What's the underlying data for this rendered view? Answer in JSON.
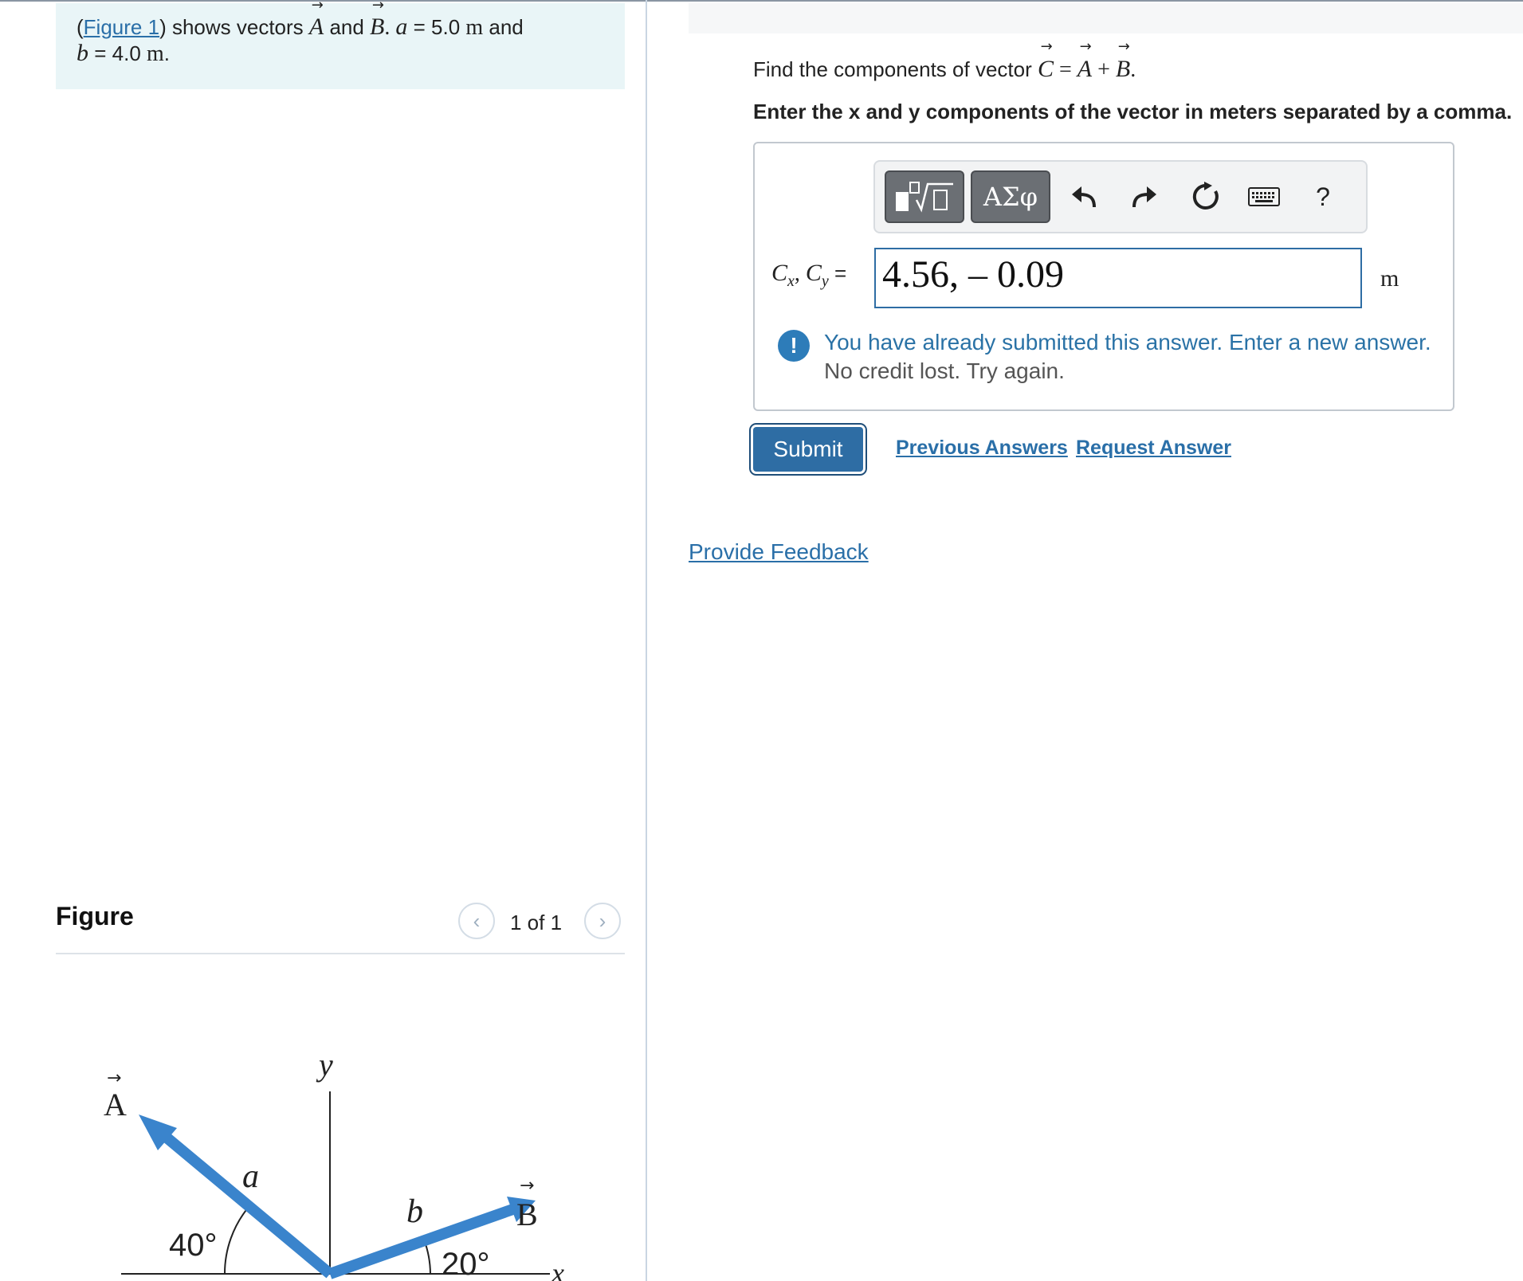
{
  "intro": {
    "open_paren": "(",
    "figure_link": "Figure 1",
    "text1": ") shows vectors ",
    "vec_A": "A",
    "and1": " and ",
    "vec_B": "B",
    "dot": ". ",
    "a_sym": "a",
    "a_val": " = 5.0 ",
    "unit1": "m",
    "and2": " and",
    "b_sym": "b",
    "b_val": " = 4.0 ",
    "unit2": "m",
    "end_dot": "."
  },
  "figure": {
    "title": "Figure",
    "counter": "1 of 1",
    "prev_icon": "chevron-left-icon",
    "next_icon": "chevron-right-icon",
    "labels": {
      "A": "A",
      "B": "B",
      "y": "y",
      "x": "x",
      "a": "a",
      "b": "b",
      "angle_a": "40°",
      "angle_b": "20°"
    },
    "vector_color": "#3a84cc"
  },
  "question": {
    "prefix": "Find the components of vector ",
    "C": "C",
    "eq": " = ",
    "A": "A",
    "plus": " + ",
    "B": "B",
    "end": "."
  },
  "instruction": "Enter the x and y components of the vector in meters separated by a comma.",
  "toolbar": {
    "greek": "ΑΣφ",
    "help": "?",
    "icons": [
      "templates-icon",
      "undo-icon",
      "redo-icon",
      "reset-icon",
      "keyboard-icon"
    ]
  },
  "answer": {
    "label_Cx": "C",
    "label_x": "x",
    "label_sep": ", ",
    "label_Cy": "C",
    "label_y": "y",
    "label_eq": " =",
    "value": "4.56, – 0.09",
    "unit": "m"
  },
  "alert": {
    "icon": "!",
    "message": "You have already submitted this answer. Enter a new answer.",
    "sub": "No credit lost. Try again."
  },
  "actions": {
    "submit": "Submit",
    "previous_answers": "Previous Answers",
    "request_answer": "Request Answer",
    "feedback": "Provide Feedback"
  },
  "colors": {
    "accent": "#2e6da4",
    "intro_bg": "#e9f5f7",
    "link": "#2a6fa8"
  }
}
